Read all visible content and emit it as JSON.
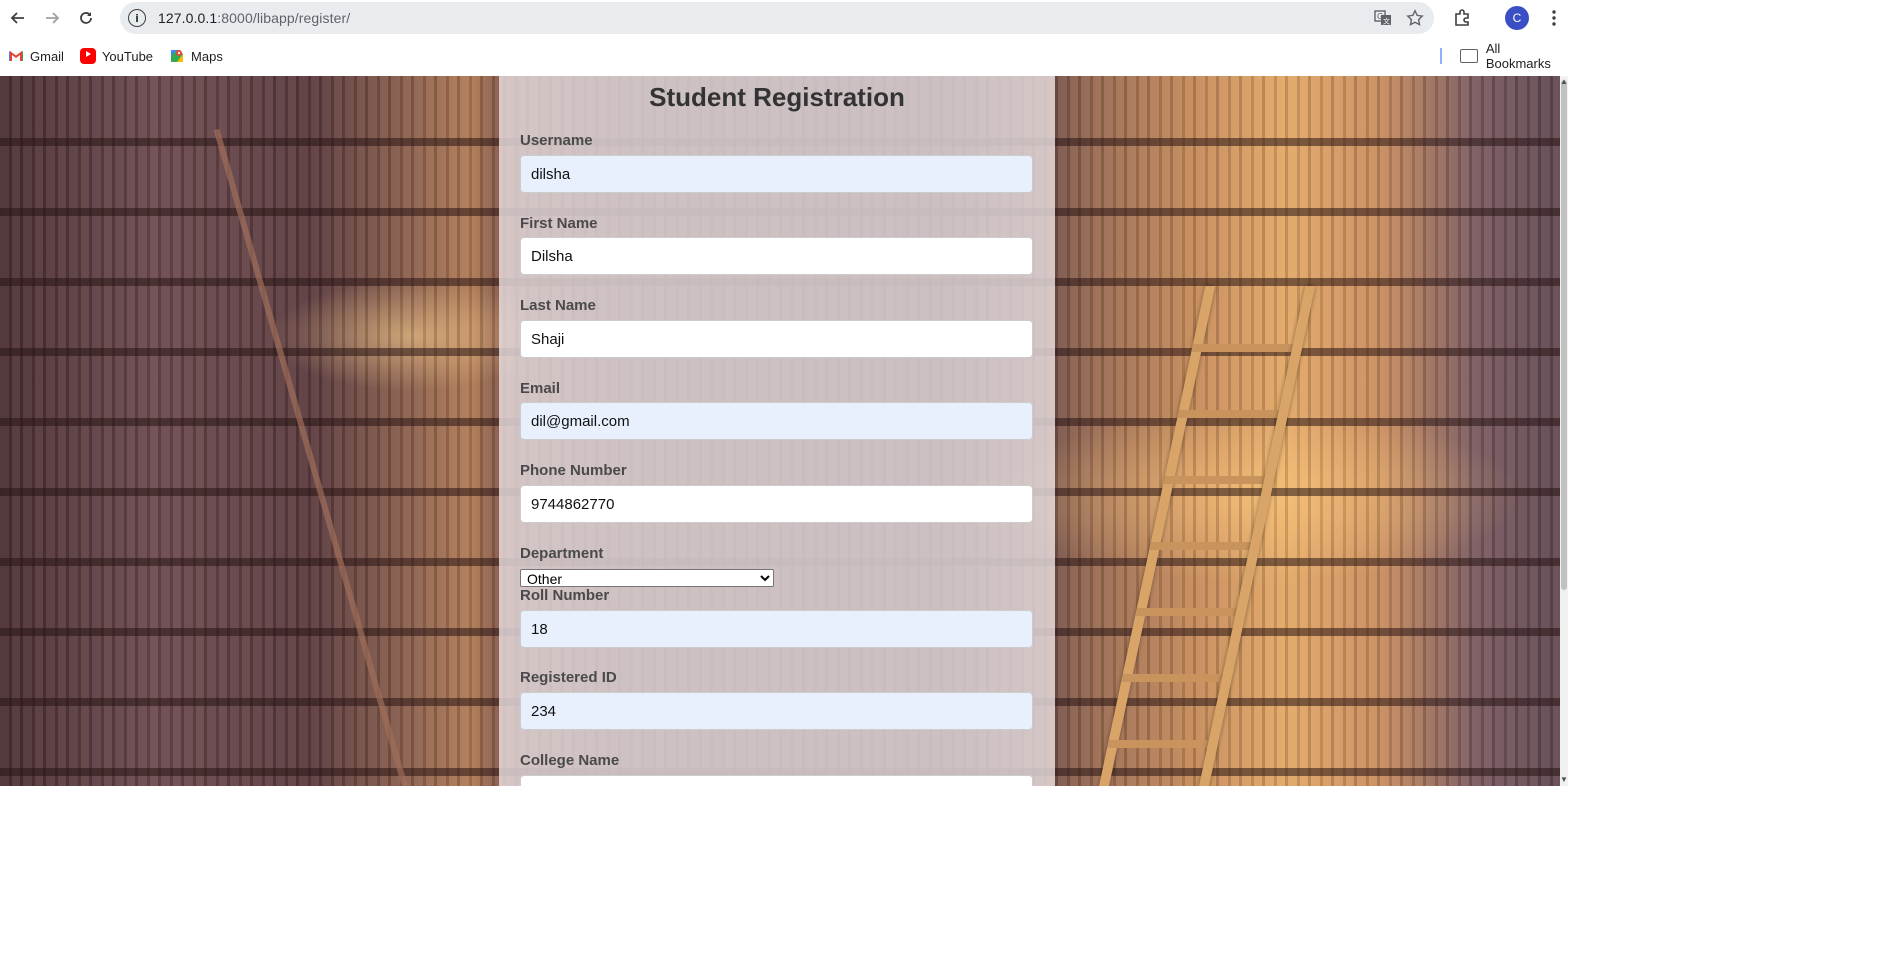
{
  "browser": {
    "url_host": "127.0.0.1",
    "url_rest": ":8000/libapp/register/",
    "profile_initial": "C",
    "bookmarks": [
      {
        "label": "Gmail",
        "icon": "gmail-icon"
      },
      {
        "label": "YouTube",
        "icon": "youtube-icon"
      },
      {
        "label": "Maps",
        "icon": "maps-icon"
      }
    ],
    "all_bookmarks_label": "All Bookmarks"
  },
  "form": {
    "title": "Student Registration",
    "fields": {
      "username": {
        "label": "Username",
        "value": "dilsha"
      },
      "first_name": {
        "label": "First Name",
        "value": "Dilsha"
      },
      "last_name": {
        "label": "Last Name",
        "value": "Shaji"
      },
      "email": {
        "label": "Email",
        "value": "dil@gmail.com"
      },
      "phone": {
        "label": "Phone Number",
        "value": "9744862770"
      },
      "department": {
        "label": "Department",
        "selected": "Other"
      },
      "roll_number": {
        "label": "Roll Number",
        "value": "18"
      },
      "registered_id": {
        "label": "Registered ID",
        "value": "234"
      },
      "college_name": {
        "label": "College Name",
        "value": ""
      }
    }
  },
  "colors": {
    "autofill_bg": "#e8f0fe",
    "panel_bg": "rgba(236,226,228,0.80)",
    "profile_bg": "#3b4fc4"
  }
}
